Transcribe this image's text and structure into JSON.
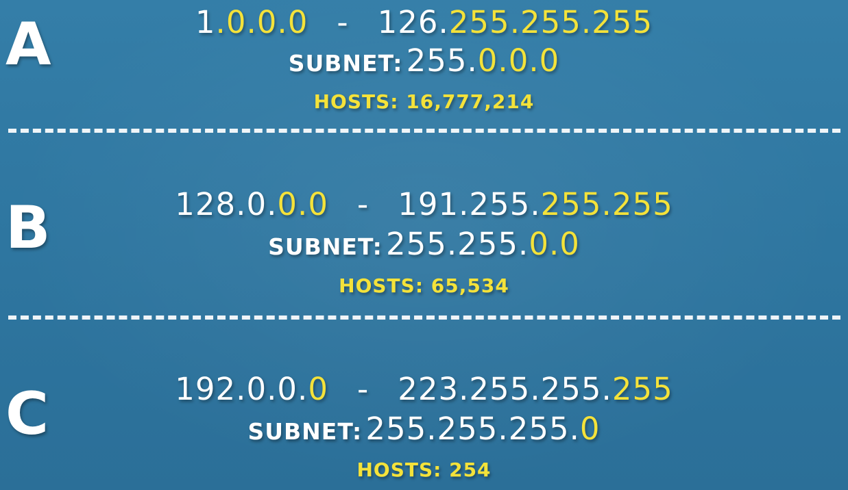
{
  "colors": {
    "background": "#2f77a0",
    "text": "#ffffff",
    "highlight": "#f4e23a"
  },
  "classes": [
    {
      "letter": "A",
      "range_start_net": "1",
      "range_start_host": ".0.0.0",
      "separator": "-",
      "range_end_net": "126.",
      "range_end_host": "255.255.255",
      "subnet_label": "SUBNET:",
      "subnet_net": "255.",
      "subnet_host": "0.0.0",
      "hosts": "HOSTS: 16,777,214"
    },
    {
      "letter": "B",
      "range_start_net": "128.0.",
      "range_start_host": "0.0",
      "separator": "-",
      "range_end_net": "191.255.",
      "range_end_host": "255.255",
      "subnet_label": "SUBNET:",
      "subnet_net": "255.255.",
      "subnet_host": "0.0",
      "hosts": "HOSTS: 65,534"
    },
    {
      "letter": "C",
      "range_start_net": "192.0.0.",
      "range_start_host": "0",
      "separator": "-",
      "range_end_net": "223.255.255.",
      "range_end_host": "255",
      "subnet_label": "SUBNET:",
      "subnet_net": "255.255.255.",
      "subnet_host": "0",
      "hosts": "HOSTS: 254"
    }
  ]
}
